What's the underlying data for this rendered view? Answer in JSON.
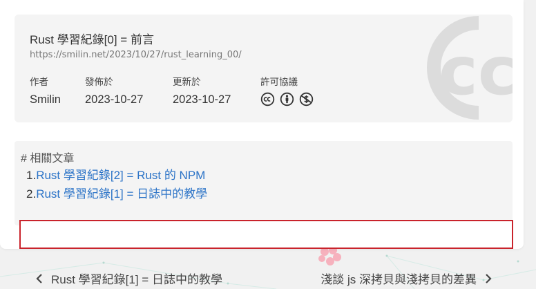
{
  "license": {
    "title": "Rust 學習紀錄[0] = 前言",
    "url": "https://smilin.net/2023/10/27/rust_learning_00/",
    "author_label": "作者",
    "author": "Smilin",
    "published_label": "發佈於",
    "published": "2023-10-27",
    "updated_label": "更新於",
    "updated": "2023-10-27",
    "license_label": "許可協議",
    "license_icons": [
      "cc-icon",
      "by-icon",
      "nc-icon"
    ]
  },
  "related": {
    "heading": "# 相關文章",
    "items": [
      {
        "num": "1.",
        "title": "Rust 學習紀錄[2] = Rust 的 NPM"
      },
      {
        "num": "2.",
        "title": "Rust 學習紀錄[1] = 日誌中的教學"
      }
    ]
  },
  "nav": {
    "prev": "Rust 學習紀錄[1] = 日誌中的教學",
    "next": "淺談 js 深拷貝與淺拷貝的差異"
  },
  "colors": {
    "link": "#2b73c7",
    "highlight_border": "#c9232b",
    "watermark": "#dcdcdc"
  }
}
